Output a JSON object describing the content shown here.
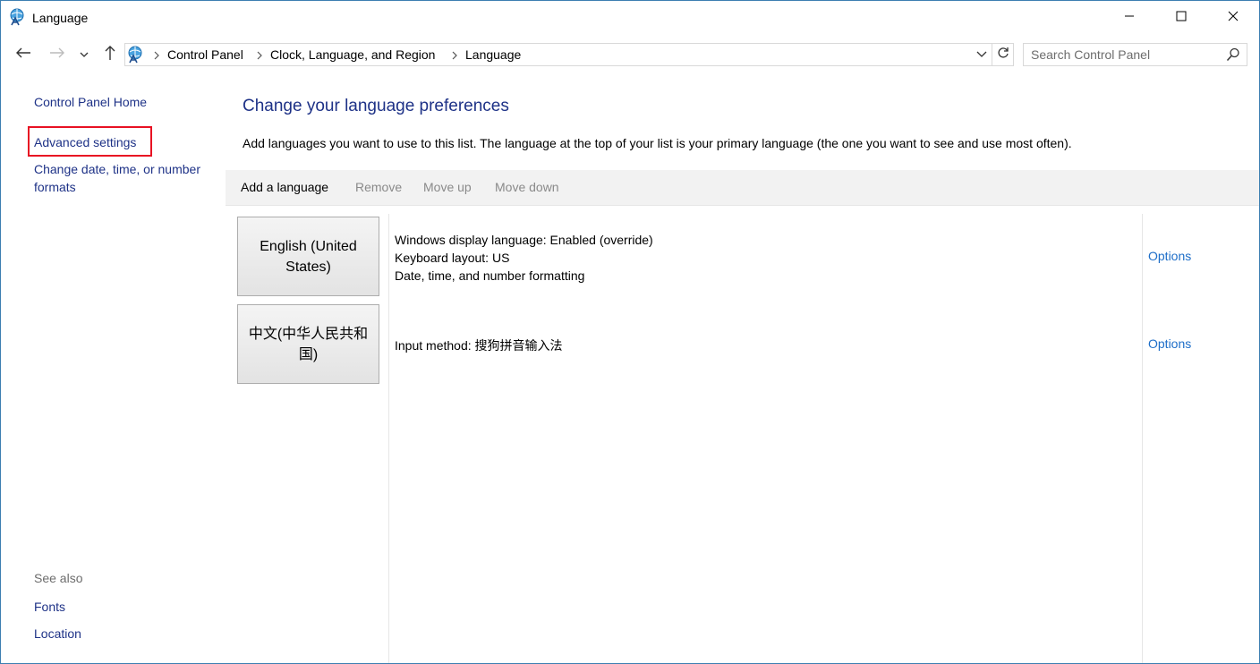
{
  "window": {
    "title": "Language",
    "icon": "globe-language-icon"
  },
  "titlebar_buttons": [
    "minimize-icon",
    "maximize-icon",
    "close-icon"
  ],
  "navigation": {
    "breadcrumbs": [
      "Control Panel",
      "Clock, Language, and Region",
      "Language"
    ],
    "search_placeholder": "Search Control Panel"
  },
  "sidebar": {
    "home": "Control Panel Home",
    "advanced_settings": "Advanced settings",
    "date_time_formats": "Change date, time, or number formats",
    "see_also_label": "See also",
    "see_also_links": [
      "Fonts",
      "Location"
    ]
  },
  "highlight": {
    "color": "#e81123",
    "target": "Advanced settings"
  },
  "main": {
    "heading": "Change your language preferences",
    "description": "Add languages you want to use to this list. The language at the top of your list is your primary language (the one you want to see and use most often).",
    "toolbar": {
      "add": "Add a language",
      "remove": "Remove",
      "move_up": "Move up",
      "move_down": "Move down"
    },
    "languages": [
      {
        "name": "English (United States)",
        "details": [
          "Windows display language: Enabled (override)",
          "Keyboard layout: US",
          "Date, time, and number formatting"
        ],
        "options": "Options"
      },
      {
        "name": "中文(中华人民共和国)",
        "details": [
          "Input method: 搜狗拼音输入法"
        ],
        "options": "Options"
      }
    ]
  },
  "colors": {
    "link": "#1e3287",
    "options_link": "#1e6ec8",
    "disabled_text": "#8a8a8a",
    "toolbar_bg": "#f2f2f2"
  }
}
